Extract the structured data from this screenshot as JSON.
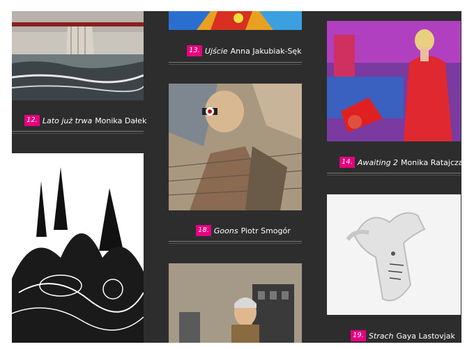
{
  "items": [
    {
      "num": "12.",
      "title": "Lato już trwa",
      "artist": "Monika Dałek",
      "image": "harbor-painting"
    },
    {
      "num": "13.",
      "title": "Ujście",
      "artist": "Anna Jakubiak-Sęk",
      "image": "colorful-abstract-painting"
    },
    {
      "num": "14.",
      "title": "Awaiting 2",
      "artist": "Monika Ratajczak",
      "image": "woman-red-dress-painting"
    },
    {
      "num": "18.",
      "title": "Goons",
      "artist": "Piotr Smogór",
      "image": "gunman-collage"
    },
    {
      "num": "19.",
      "title": "Strach",
      "artist": "Gaya Lastovjak",
      "image": "white-relief-sculpture"
    },
    {
      "image": "black-white-cathedral-drawing"
    },
    {
      "image": "city-portrait-painting"
    }
  ],
  "colors": {
    "accent": "#e6007e",
    "background": "#2d2d2d"
  }
}
